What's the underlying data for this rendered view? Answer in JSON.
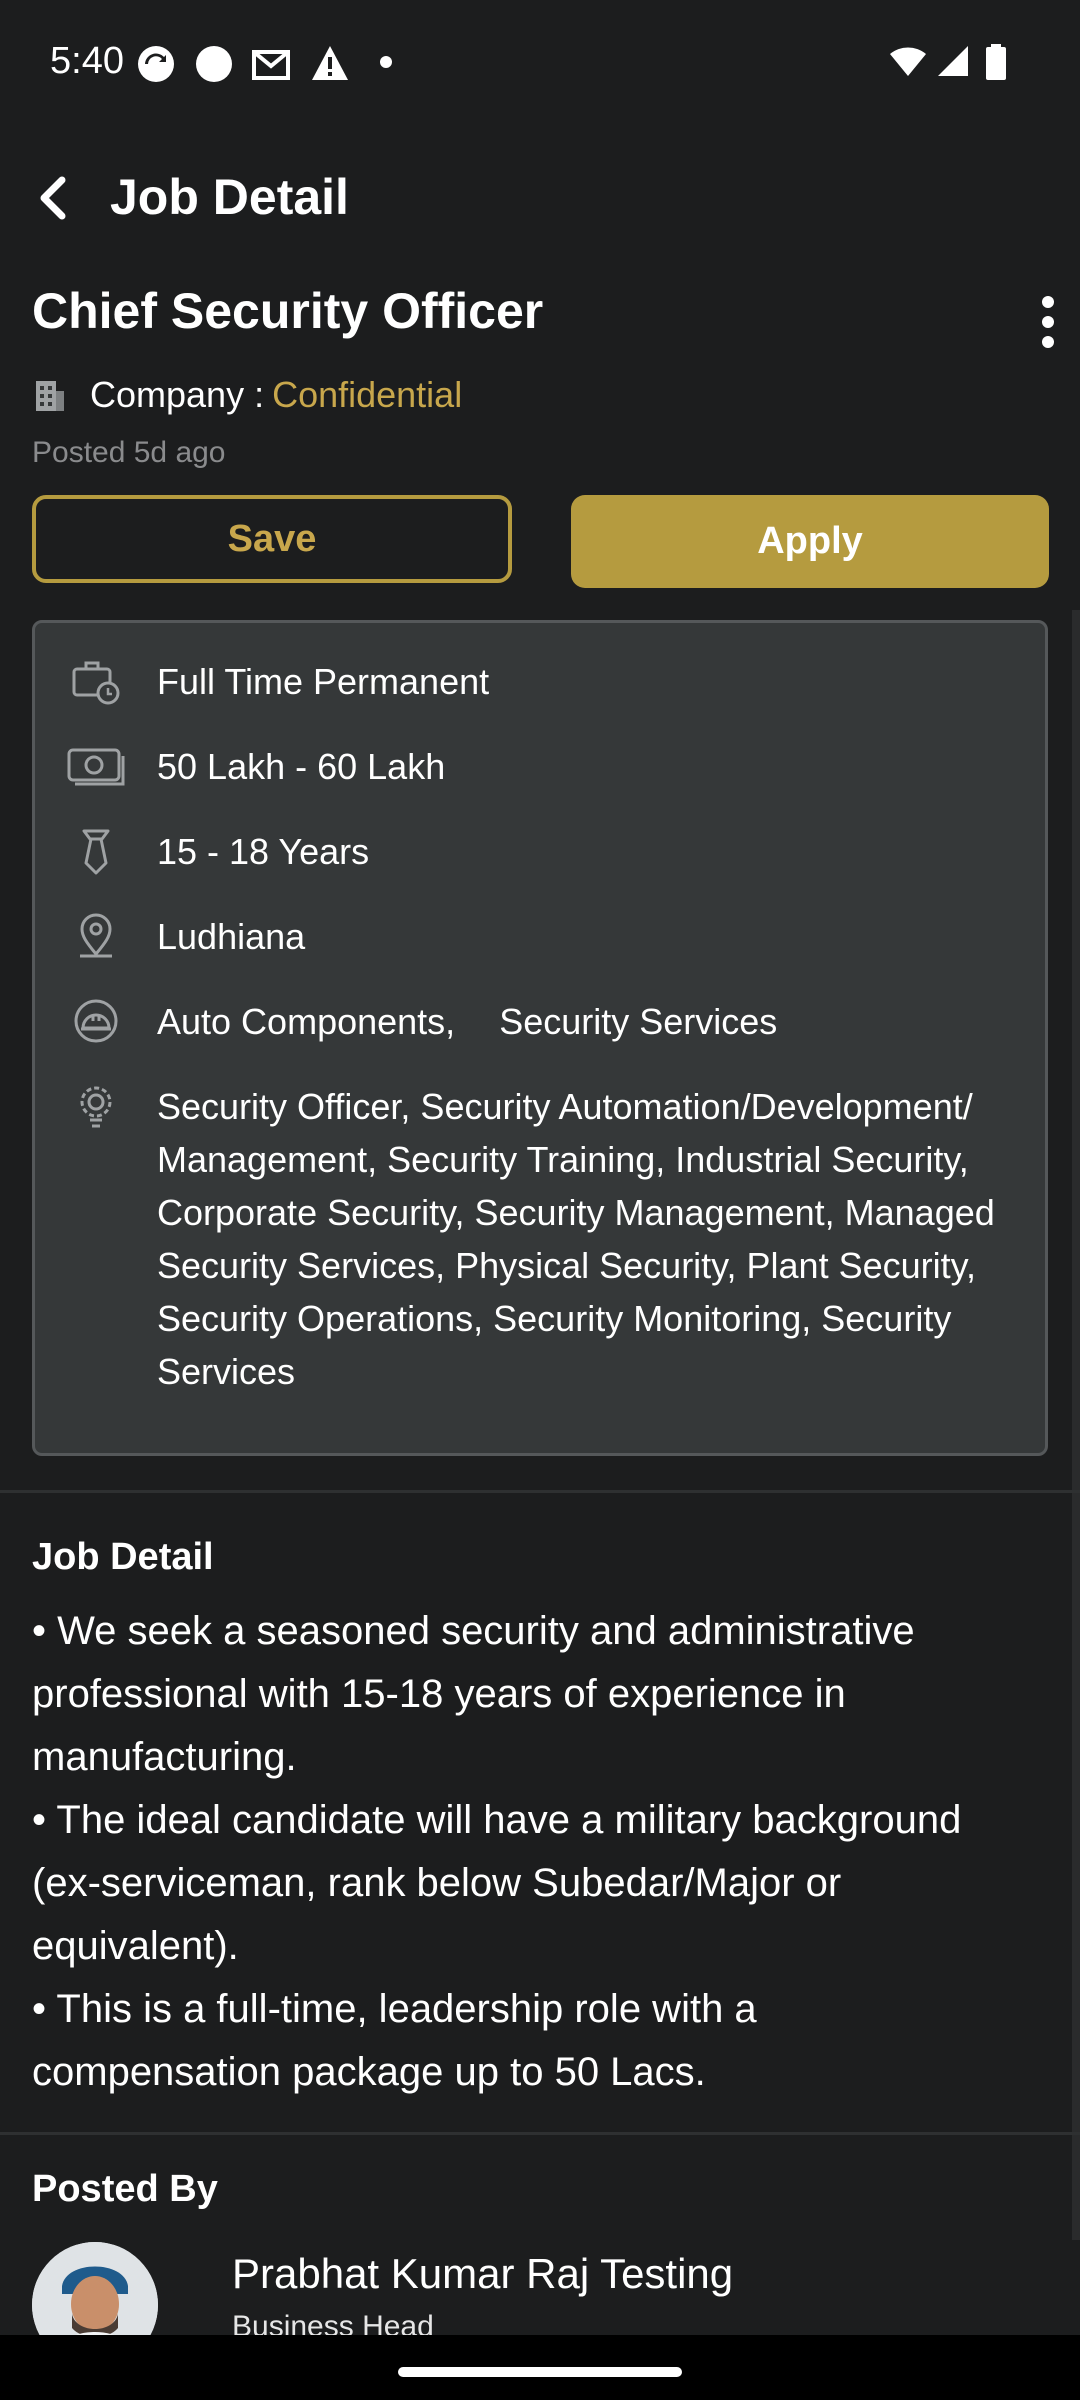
{
  "status_bar": {
    "time": "5:40"
  },
  "app_bar": {
    "title": "Job Detail"
  },
  "job": {
    "title": "Chief Security Officer",
    "company_label": "Company :",
    "company_value": "Confidential",
    "posted": "Posted 5d ago"
  },
  "actions": {
    "save": "Save",
    "apply": "Apply"
  },
  "info": {
    "job_type": "Full Time Permanent",
    "salary": "50 Lakh - 60 Lakh",
    "experience": "15  - 18 Years",
    "location": "Ludhiana",
    "industries": [
      "Auto Components,",
      "Security Services"
    ],
    "skills_lines": [
      "Security Officer, Security Automation/Development/",
      "Management, Security Training, Industrial Security,",
      "Corporate Security, Security Management, Managed",
      "Security Services, Physical Security, Plant Security,",
      "Security Operations, Security Monitoring, Security",
      "Services"
    ]
  },
  "job_detail": {
    "heading": "Job Detail",
    "lines": [
      "• We seek a seasoned security and administrative",
      "professional with 15-18 years of experience in",
      "manufacturing.",
      "• The ideal candidate will have a military background",
      "(ex-serviceman, rank below Subedar/Major or",
      "equivalent).",
      "• This is a full-time, leadership role with a",
      "compensation package up to 50 Lacs."
    ]
  },
  "posted_by": {
    "heading": "Posted By",
    "name": "Prabhat Kumar Raj Testing",
    "role": "Business Head"
  },
  "colors": {
    "accent": "#b59b3f",
    "background": "#1c1d1e",
    "card": "#353839"
  },
  "icons": [
    "back-arrow-icon",
    "more-vert-icon",
    "building-icon",
    "briefcase-clock-icon",
    "cash-icon",
    "tie-icon",
    "location-pin-icon",
    "helmet-icon",
    "skills-gear-icon"
  ]
}
